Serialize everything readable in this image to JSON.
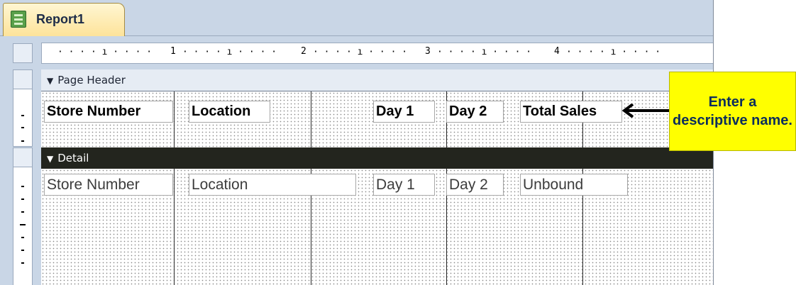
{
  "tab": {
    "title": "Report1",
    "icon": "report-icon"
  },
  "ruler": {
    "numbers": [
      "1",
      "2",
      "3",
      "4"
    ]
  },
  "sections": {
    "page_header": {
      "label": "Page Header",
      "icon": "section-arrow-icon"
    },
    "detail": {
      "label": "Detail",
      "icon": "section-arrow-icon"
    }
  },
  "header_labels": [
    "Store Number",
    "Location",
    "Day 1",
    "Day 2",
    "Total Sales"
  ],
  "detail_fields": [
    "Store Number",
    "Location",
    "Day 1",
    "Day 2",
    "Unbound"
  ],
  "callout": {
    "text": "Enter a descriptive name.",
    "color": "#ffff00"
  },
  "colors": {
    "detail_bar": "#23251e",
    "tab": "#fde39a",
    "background": "#c9d6e6"
  }
}
